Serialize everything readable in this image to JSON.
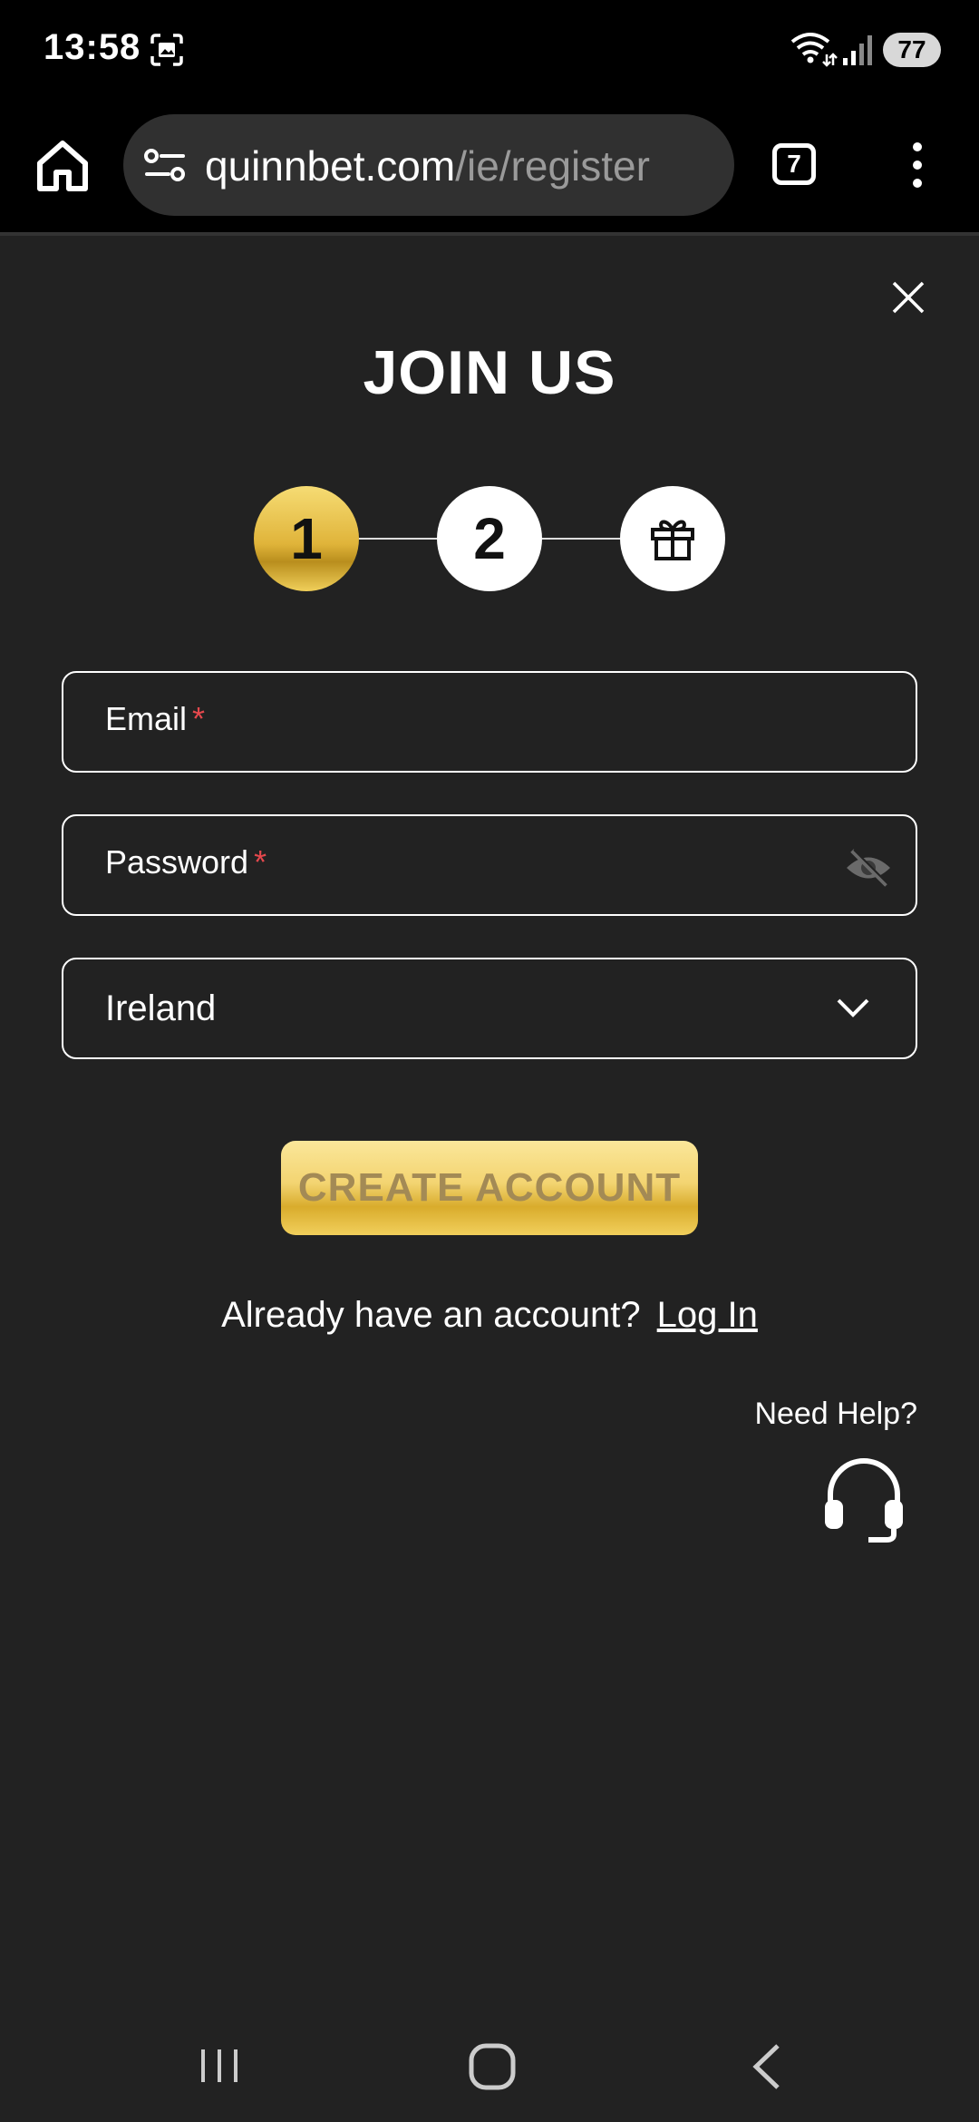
{
  "status_bar": {
    "time": "13:58",
    "battery": "77"
  },
  "browser": {
    "url_host": "quinnbet.com",
    "url_path": "/ie/register",
    "tab_count": "7"
  },
  "page": {
    "title": "JOIN US",
    "steps": [
      "1",
      "2"
    ],
    "email_label": "Email",
    "password_label": "Password",
    "required_mark": "*",
    "country_value": "Ireland",
    "create_button": "CREATE ACCOUNT",
    "login_prompt": "Already have an account?",
    "login_link": "Log In",
    "help_text": "Need Help?"
  },
  "colors": {
    "background": "#222222",
    "gold": "#e0b43a",
    "required": "#e5484d"
  },
  "icons": [
    "screenshot-icon",
    "wifi-icon",
    "signal-icon",
    "home-icon",
    "site-settings-icon",
    "tabs-icon",
    "menu-icon",
    "close-icon",
    "gift-icon",
    "eye-off-icon",
    "chevron-down-icon",
    "headset-icon",
    "recent-apps-icon",
    "nav-home-icon",
    "back-icon"
  ]
}
